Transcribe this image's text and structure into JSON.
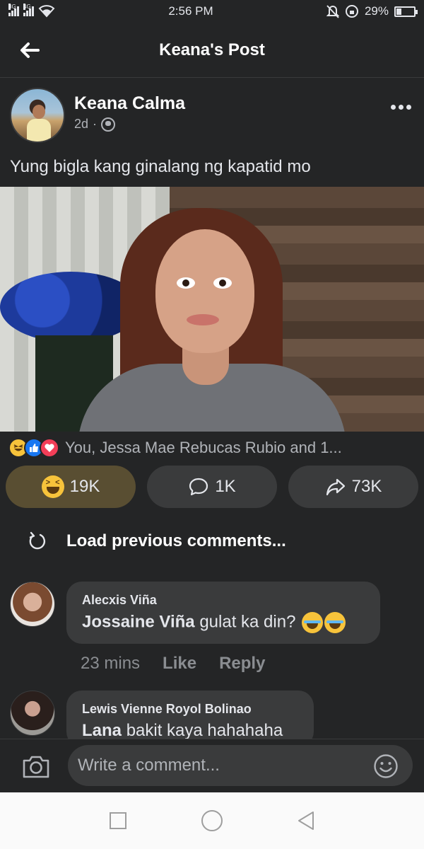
{
  "status_bar": {
    "network_1": "3G",
    "network_2": "4G",
    "time": "2:56 PM",
    "battery": "29%",
    "battery_level": 0.29
  },
  "header": {
    "title": "Keana's Post"
  },
  "post": {
    "author": "Keana Calma",
    "time": "2d",
    "separator": "·",
    "text": "Yung bigla kang ginalang ng kapatid mo",
    "reactions_summary": "You, Jessa Mae Rebucas Rubio and 1...",
    "reaction_count": "19K",
    "comment_count": "1K",
    "share_count": "73K"
  },
  "comments_section": {
    "load_previous": "Load previous comments...",
    "comments": [
      {
        "author": "Alecxis Viña",
        "mention": "Jossaine Viña",
        "text": "gulat ka din?",
        "time": "23 mins",
        "like": "Like",
        "reply": "Reply"
      },
      {
        "author": "Lewis Vienne Royol Bolinao",
        "mention": "Lana",
        "text": "bakit kaya hahahaha"
      }
    ]
  },
  "composer": {
    "placeholder": "Write a comment..."
  },
  "colors": {
    "background": "#242526",
    "bubble": "#3a3b3c",
    "haha_active": "#594e32",
    "like_blue": "#1877f2",
    "love_red": "#f33e58",
    "haha_yellow": "#f7c33b"
  }
}
